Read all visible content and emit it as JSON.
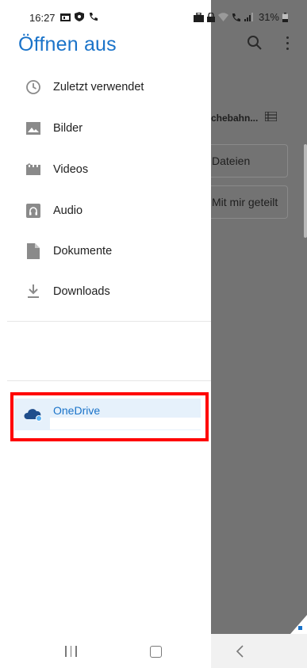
{
  "status_bar": {
    "time": "16:27",
    "battery": "31%"
  },
  "drawer": {
    "title": "Öffnen aus",
    "items": [
      {
        "label": "Zuletzt verwendet",
        "icon": "clock-icon"
      },
      {
        "label": "Bilder",
        "icon": "image-icon"
      },
      {
        "label": "Videos",
        "icon": "video-icon"
      },
      {
        "label": "Audio",
        "icon": "audio-icon"
      },
      {
        "label": "Dokumente",
        "icon": "document-icon"
      },
      {
        "label": "Downloads",
        "icon": "download-icon"
      }
    ],
    "apps": [
      {
        "label": "OneDrive",
        "icon": "onedrive-icon",
        "selected": true
      }
    ]
  },
  "background_app": {
    "breadcrumb": "chebahn...",
    "cards": [
      "Dateien",
      "Mit mir geteilt"
    ]
  },
  "colors": {
    "accent": "#1a73c9",
    "highlight_border": "#ff0000",
    "scrim": "#737373"
  }
}
